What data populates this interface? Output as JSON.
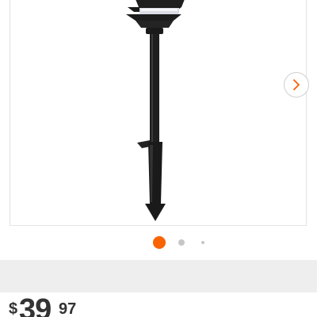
{
  "gallery": {
    "image_name": "landscape-path-light",
    "next_icon": "chevron-right-icon",
    "dots": [
      "active",
      "inactive",
      "inactive"
    ],
    "accent_color": "#f96302"
  },
  "price": {
    "currency_symbol": "$",
    "dollars": "39",
    "cents": "97"
  }
}
